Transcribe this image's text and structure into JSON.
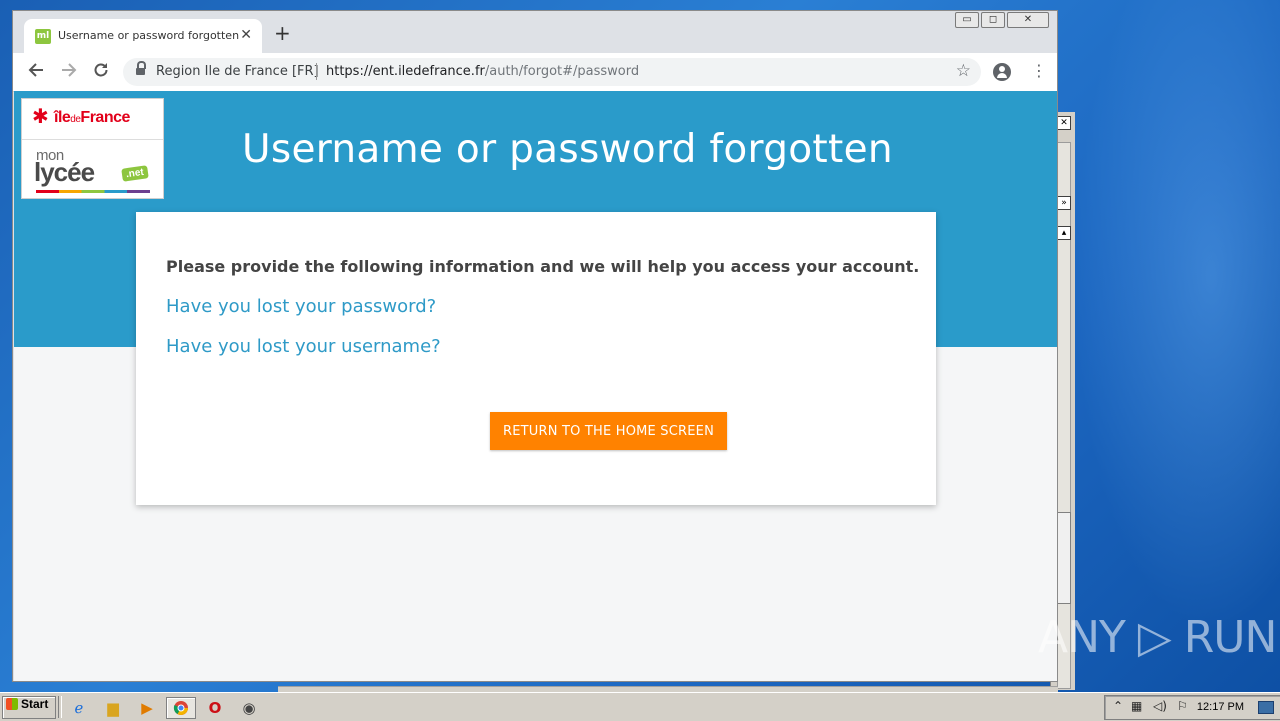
{
  "browser": {
    "tab_title": "Username or password forgotten",
    "favicon_text": "ml",
    "tab_close": "✕",
    "new_tab": "+",
    "site_name": "Region Ile de France [FR]",
    "url_host": "https://ent.iledefrance.fr",
    "url_path": "/auth/forgot#/password",
    "window_controls": [
      "▭",
      "◻",
      "✕"
    ]
  },
  "logo": {
    "region_prefix": "île",
    "region_de": "de",
    "region_suffix": "France",
    "mon": "mon",
    "lycee": "lycée",
    "net": ".net"
  },
  "page": {
    "heading": "Username or password forgotten",
    "intro": "Please provide the following information and we will help you access your account.",
    "lost_password_link": "Have you lost your password?",
    "lost_username_link": "Have you lost your username?",
    "home_button": "RETURN TO THE HOME SCREEN"
  },
  "colors": {
    "hero_blue": "#2a9bca",
    "link_blue": "#2e9ac7",
    "button_orange": "#ff8200",
    "region_red": "#e2001a"
  },
  "watermark": "ANY ▷ RUN",
  "taskbar": {
    "start_label": "Start",
    "clock": "12:17 PM"
  }
}
